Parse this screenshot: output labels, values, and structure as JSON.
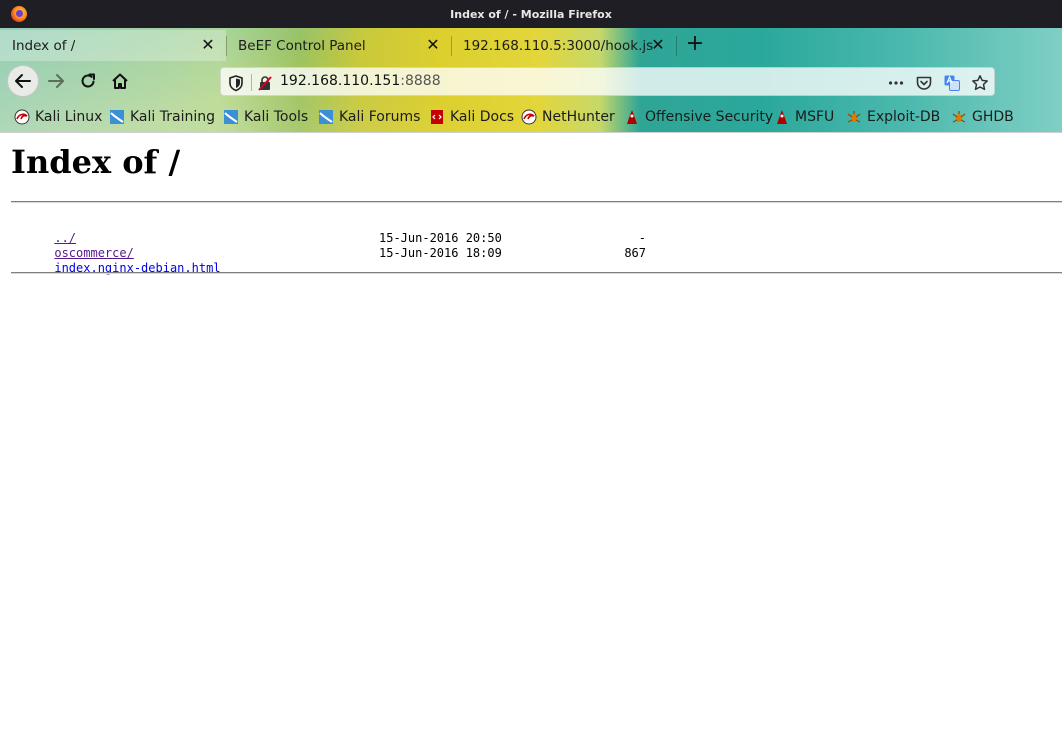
{
  "window": {
    "title": "Index of / - Mozilla Firefox"
  },
  "tabs": [
    {
      "label": "Index of /",
      "active": true
    },
    {
      "label": "BeEF Control Panel",
      "active": false
    },
    {
      "label": "192.168.110.5:3000/hook.js",
      "active": false
    }
  ],
  "tab_close_glyph": "✕",
  "new_tab_glyph": "+",
  "url": {
    "host": "192.168.110.151",
    "port": ":8888"
  },
  "bookmarks": [
    {
      "label": "Kali Linux",
      "icon": "kali-dragon-icon"
    },
    {
      "label": "Kali Training",
      "icon": "kali-training-icon"
    },
    {
      "label": "Kali Tools",
      "icon": "kali-tools-icon"
    },
    {
      "label": "Kali Forums",
      "icon": "kali-forums-icon"
    },
    {
      "label": "Kali Docs",
      "icon": "kali-docs-icon"
    },
    {
      "label": "NetHunter",
      "icon": "nethunter-icon"
    },
    {
      "label": "Offensive Security",
      "icon": "offsec-icon"
    },
    {
      "label": "MSFU",
      "icon": "msfu-icon"
    },
    {
      "label": "Exploit-DB",
      "icon": "exploit-db-icon"
    },
    {
      "label": "GHDB",
      "icon": "ghdb-icon"
    }
  ],
  "page": {
    "heading": "Index of /",
    "entries": [
      {
        "name": "../",
        "date": "",
        "size": ""
      },
      {
        "name": "oscommerce/",
        "date": "15-Jun-2016 20:50",
        "size": "-"
      },
      {
        "name": "index.nginx-debian.html",
        "date": "15-Jun-2016 18:09",
        "size": "867"
      }
    ]
  },
  "colors": {
    "link_visited": "#551a8b",
    "link": "#0000ee",
    "titlebar": "#1e1e24"
  }
}
